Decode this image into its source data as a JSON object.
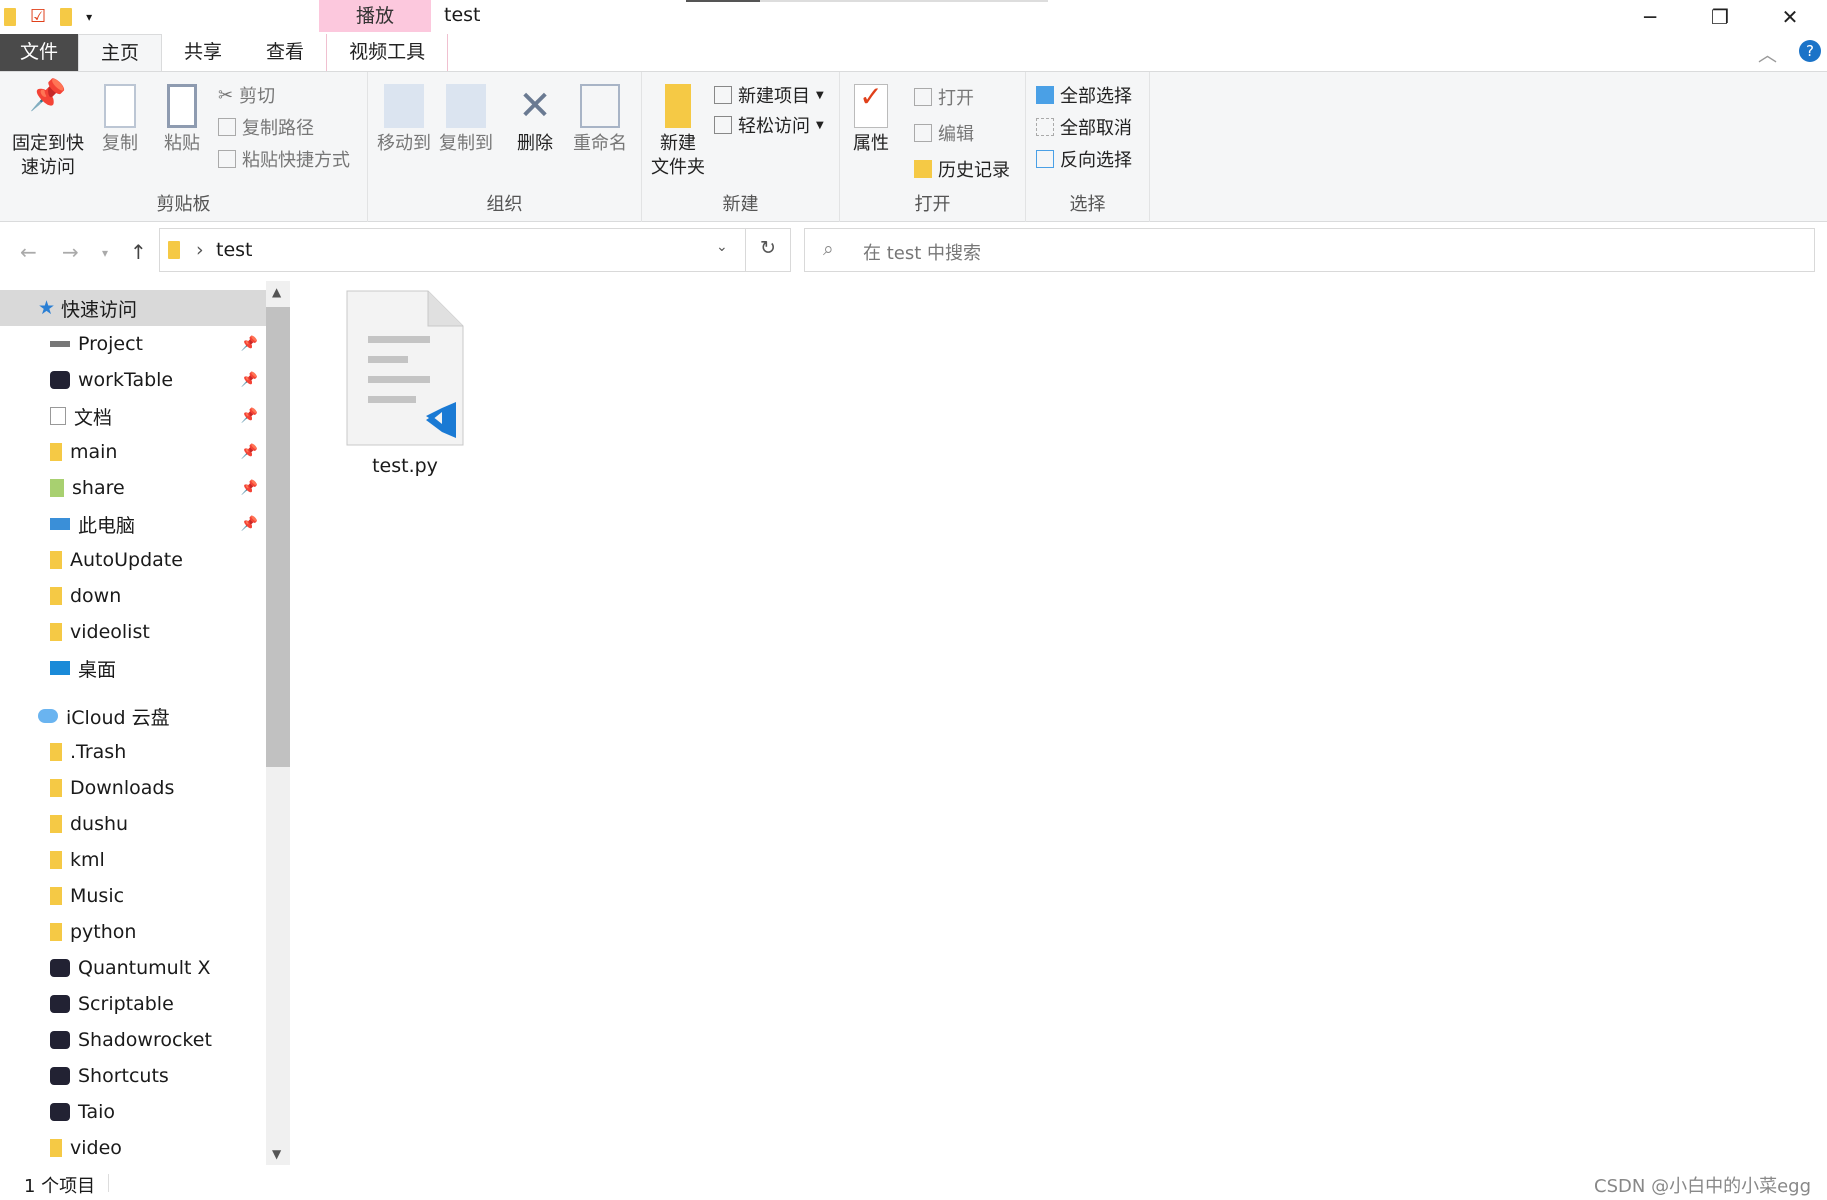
{
  "window": {
    "title": "test",
    "context_tab": "播放",
    "minimize": "─",
    "restore": "❐",
    "close": "✕"
  },
  "tabs": [
    {
      "label": "文件"
    },
    {
      "label": "主页"
    },
    {
      "label": "共享"
    },
    {
      "label": "查看"
    },
    {
      "label": "视频工具"
    }
  ],
  "ribbon": {
    "clipboard": {
      "label": "剪贴板",
      "pin": "固定到快\n速访问",
      "pin1": "固定到快",
      "pin2": "速访问",
      "copy": "复制",
      "paste": "粘贴",
      "cut": "剪切",
      "copy_path": "复制路径",
      "paste_shortcut": "粘贴快捷方式"
    },
    "organize": {
      "label": "组织",
      "move_to": "移动到",
      "copy_to": "复制到",
      "delete": "删除",
      "rename": "重命名"
    },
    "new": {
      "label": "新建",
      "new_folder1": "新建",
      "new_folder2": "文件夹",
      "new_item": "新建项目",
      "easy_access": "轻松访问"
    },
    "open": {
      "label": "打开",
      "properties": "属性",
      "open": "打开",
      "edit": "编辑",
      "history": "历史记录"
    },
    "select": {
      "label": "选择",
      "select_all": "全部选择",
      "select_none": "全部取消",
      "invert": "反向选择"
    }
  },
  "address": {
    "path": "test",
    "search_placeholder": "在 test 中搜索"
  },
  "sidebar": {
    "items": [
      {
        "label": "快速访问",
        "icon": "star-icon",
        "level": 0,
        "selected": true
      },
      {
        "label": "Project",
        "icon": "drive-icon",
        "pinned": true
      },
      {
        "label": "workTable",
        "icon": "app-icon",
        "pinned": true
      },
      {
        "label": "文档",
        "icon": "document-icon",
        "pinned": true
      },
      {
        "label": "main",
        "icon": "folder-icon",
        "pinned": true
      },
      {
        "label": "share",
        "icon": "folder-user-icon",
        "pinned": true
      },
      {
        "label": "此电脑",
        "icon": "computer-icon",
        "pinned": true
      },
      {
        "label": "AutoUpdate",
        "icon": "folder-icon"
      },
      {
        "label": "down",
        "icon": "folder-icon"
      },
      {
        "label": "videolist",
        "icon": "folder-icon"
      },
      {
        "label": "桌面",
        "icon": "desktop-icon"
      },
      {
        "label": "",
        "gap": true
      },
      {
        "label": "iCloud 云盘",
        "icon": "cloud-icon",
        "level": 0
      },
      {
        "label": ".Trash",
        "icon": "folder-icon"
      },
      {
        "label": "Downloads",
        "icon": "folder-icon"
      },
      {
        "label": "dushu",
        "icon": "folder-icon"
      },
      {
        "label": "kml",
        "icon": "folder-icon"
      },
      {
        "label": "Music",
        "icon": "folder-icon"
      },
      {
        "label": "python",
        "icon": "folder-icon"
      },
      {
        "label": "Quantumult X",
        "icon": "app-icon"
      },
      {
        "label": "Scriptable",
        "icon": "app-icon"
      },
      {
        "label": "Shadowrocket",
        "icon": "app-icon"
      },
      {
        "label": "Shortcuts",
        "icon": "app-icon"
      },
      {
        "label": "Taio",
        "icon": "app-icon"
      },
      {
        "label": "video",
        "icon": "folder-icon"
      }
    ]
  },
  "files": [
    {
      "name": "test.py",
      "icon": "vscode-python-file-icon"
    }
  ],
  "status": {
    "count": "1 个项目"
  },
  "watermark": "CSDN @小白中的小菜egg",
  "colors": {
    "file_tab": "#4a4a4a",
    "context_tab": "#fcc8dd",
    "ribbon_bg": "#f5f6f7",
    "selected": "#d9d9d9",
    "folder": "#f5c945",
    "accent": "#1a73c8"
  }
}
